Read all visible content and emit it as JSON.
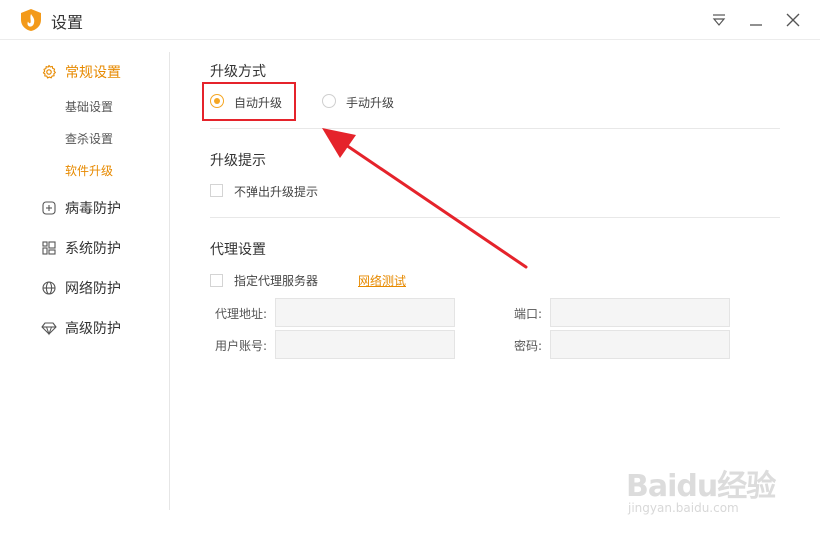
{
  "window": {
    "title": "设置"
  },
  "sidebar": {
    "groups": [
      {
        "label": "常规设置",
        "icon": "gear-icon",
        "active": true
      },
      {
        "label": "病毒防护",
        "icon": "plus-square-icon"
      },
      {
        "label": "系统防护",
        "icon": "grid-icon"
      },
      {
        "label": "网络防护",
        "icon": "globe-icon"
      },
      {
        "label": "高级防护",
        "icon": "diamond-icon"
      }
    ],
    "subitems": [
      {
        "label": "基础设置"
      },
      {
        "label": "查杀设置"
      },
      {
        "label": "软件升级",
        "active": true
      }
    ]
  },
  "upgrade_mode": {
    "title": "升级方式",
    "options": [
      {
        "label": "自动升级",
        "checked": true
      },
      {
        "label": "手动升级",
        "checked": false
      }
    ]
  },
  "upgrade_prompt": {
    "title": "升级提示",
    "checkbox_label": "不弹出升级提示"
  },
  "proxy": {
    "title": "代理设置",
    "checkbox_label": "指定代理服务器",
    "test_link": "网络测试",
    "fields": {
      "address": {
        "label": "代理地址:",
        "value": ""
      },
      "port": {
        "label": "端口:",
        "value": ""
      },
      "username": {
        "label": "用户账号:",
        "value": ""
      },
      "password": {
        "label": "密码:",
        "value": ""
      }
    }
  },
  "watermark": {
    "brand": "Baidu经验",
    "url": "jingyan.baidu.com"
  },
  "colors": {
    "accent": "#e78a00",
    "radio": "#f5a623",
    "annotation": "#e5232b"
  }
}
